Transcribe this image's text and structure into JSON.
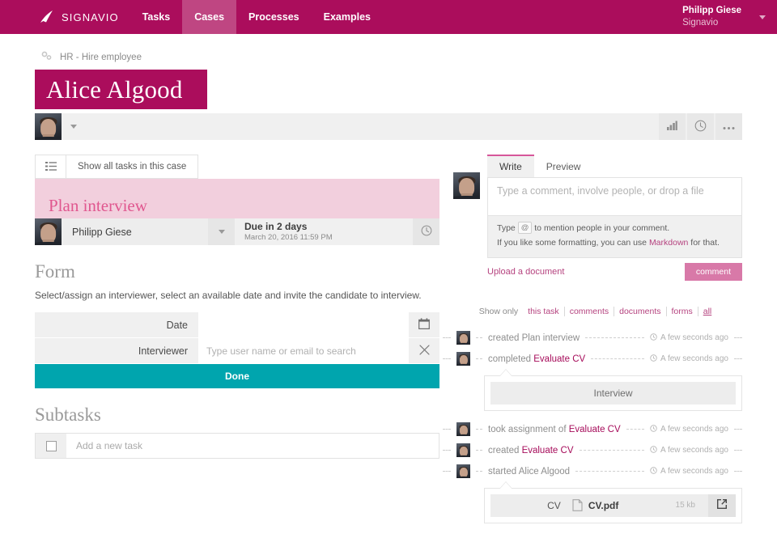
{
  "topnav": {
    "brand": "SIGNAVIO",
    "items": [
      {
        "label": "Tasks",
        "active": false
      },
      {
        "label": "Cases",
        "active": true
      },
      {
        "label": "Processes",
        "active": false
      },
      {
        "label": "Examples",
        "active": false
      }
    ],
    "user": {
      "name": "Philipp Giese",
      "org": "Signavio"
    },
    "bg_color": "#ab0d5c",
    "active_tab_color": "#bf4682"
  },
  "breadcrumb": {
    "icon": "cogs-icon",
    "label": "HR - Hire employee"
  },
  "case": {
    "title": "Alice Algood",
    "banner_color": "#ab0d5c",
    "toolbar": {
      "chart_icon": "bar-chart-icon",
      "clock_icon": "clock-icon",
      "more_icon": "ellipsis-icon"
    }
  },
  "tasks_panel": {
    "list_icon": "list-icon",
    "show_all_label": "Show all tasks in this case",
    "task": {
      "title": "Plan interview",
      "title_color": "#e0578f",
      "banner_color": "#f2cfdd",
      "assignee": "Philipp Giese",
      "due_main": "Due in 2 days",
      "due_sub": "March 20, 2016 11:59 PM",
      "due_icon": "clock-icon"
    }
  },
  "form": {
    "heading": "Form",
    "description": "Select/assign an interviewer, select an available date and invite the candidate to interview.",
    "rows": [
      {
        "label": "Date",
        "value": "",
        "placeholder": "",
        "action_icon": "calendar-icon"
      },
      {
        "label": "Interviewer",
        "value": "",
        "placeholder": "Type user name or email to search",
        "action_icon": "close-icon"
      }
    ],
    "submit_label": "Done",
    "submit_color": "#00a5ae"
  },
  "subtasks": {
    "heading": "Subtasks",
    "placeholder": "Add a new task",
    "checkbox_icon": "checkbox-icon"
  },
  "comment": {
    "tabs": [
      {
        "label": "Write",
        "active": true
      },
      {
        "label": "Preview",
        "active": false
      }
    ],
    "placeholder": "Type a comment, involve people, or drop a file",
    "hint1_pre": "Type",
    "hint1_key": "@",
    "hint1_post": "to mention people in your comment.",
    "hint2_pre": "If you like some formatting, you can use",
    "hint2_link": "Markdown",
    "hint2_post": "for that.",
    "upload_label": "Upload a document",
    "submit_label": "comment",
    "submit_color": "#d879a8"
  },
  "filters": {
    "label": "Show only",
    "options": [
      {
        "label": "this task",
        "active": false
      },
      {
        "label": "comments",
        "active": false
      },
      {
        "label": "documents",
        "active": false
      },
      {
        "label": "forms",
        "active": false
      },
      {
        "label": "all",
        "active": true
      }
    ]
  },
  "activity": [
    {
      "action": "created",
      "target": "Plan interview",
      "target_link": false,
      "time": "A few seconds ago",
      "time_icon": "clock-icon"
    },
    {
      "action": "completed",
      "target": "Evaluate CV",
      "target_link": true,
      "time": "A few seconds ago",
      "time_icon": "clock-icon",
      "callout": {
        "type": "text",
        "text": "Interview"
      }
    },
    {
      "action": "took assignment of",
      "target": "Evaluate CV",
      "target_link": true,
      "time": "A few seconds ago",
      "time_icon": "clock-icon"
    },
    {
      "action": "created",
      "target": "Evaluate CV",
      "target_link": true,
      "time": "A few seconds ago",
      "time_icon": "clock-icon"
    },
    {
      "action": "started",
      "target": "Alice Algood",
      "target_link": false,
      "time": "A few seconds ago",
      "time_icon": "clock-icon",
      "callout": {
        "type": "file",
        "label": "CV",
        "file_icon": "pdf-file-icon",
        "filename": "CV.pdf",
        "size": "15 kb",
        "open_icon": "external-link-icon"
      }
    }
  ]
}
